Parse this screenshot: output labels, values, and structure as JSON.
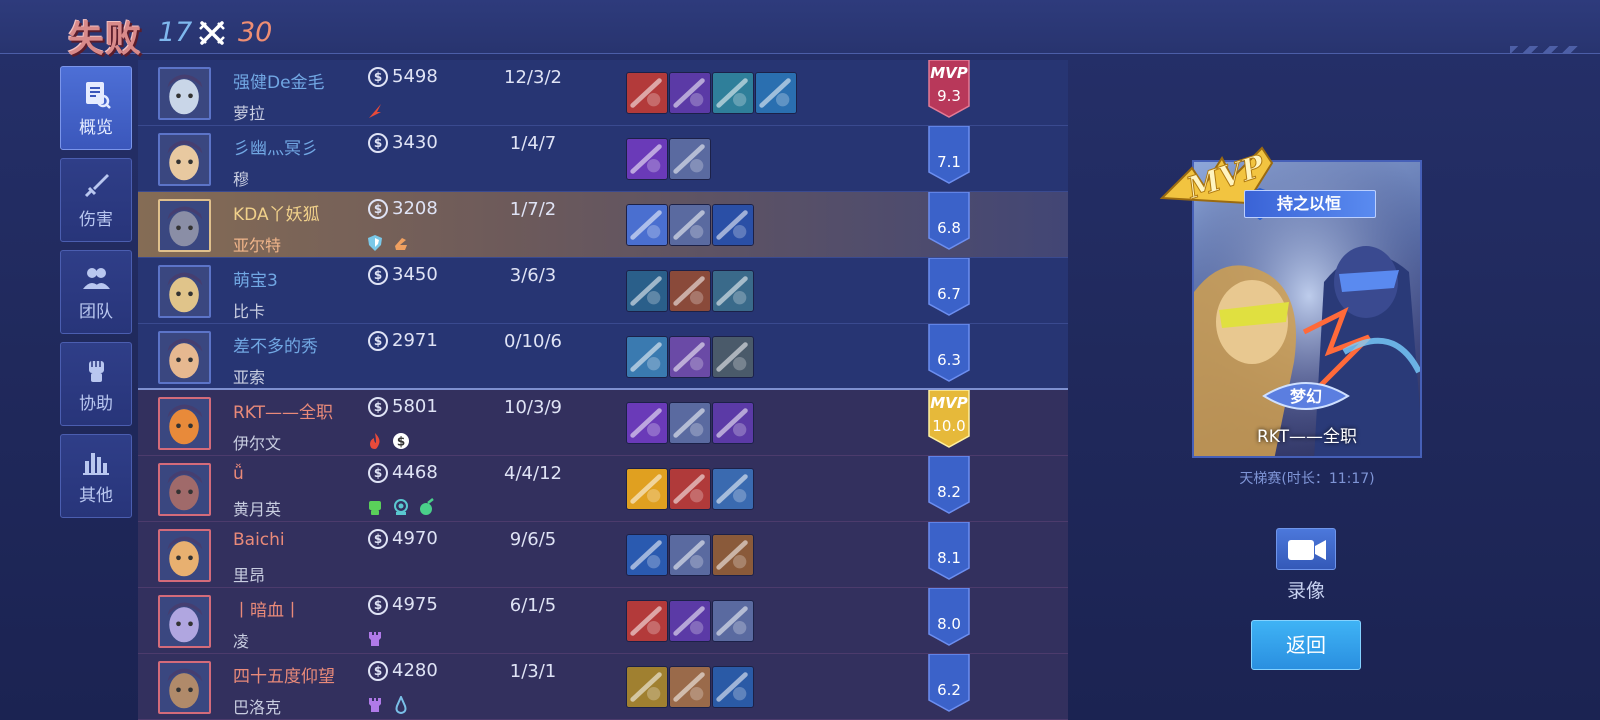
{
  "header": {
    "result": "失败",
    "score_blue": "17",
    "score_red": "30"
  },
  "sidebar": {
    "items": [
      {
        "label": "概览",
        "icon": "overview-icon",
        "active": true
      },
      {
        "label": "伤害",
        "icon": "sword-icon",
        "active": false
      },
      {
        "label": "团队",
        "icon": "team-icon",
        "active": false
      },
      {
        "label": "协助",
        "icon": "fist-icon",
        "active": false
      },
      {
        "label": "其他",
        "icon": "bar-chart-icon",
        "active": false
      }
    ]
  },
  "players": [
    {
      "team": "blue",
      "name": "强健De金毛",
      "hero": "萝拉",
      "gold": "5498",
      "kda": "12/3/2",
      "rating": "9.3",
      "mvp": true,
      "mvp_label": "MVP",
      "badges": [
        "flame-red-icon"
      ],
      "avatar_color": "#c9d6e8",
      "items": [
        "#b33a3a",
        "#5b3aa6",
        "#2f7f9a",
        "#2a6fb0"
      ]
    },
    {
      "team": "blue",
      "name": "彡幽灬冥彡",
      "hero": "穆",
      "gold": "3430",
      "kda": "1/4/7",
      "rating": "7.1",
      "mvp": false,
      "badges": [],
      "avatar_color": "#e8c9a0",
      "items": [
        "#6a3ab8",
        "#5a6aa0"
      ]
    },
    {
      "team": "blue",
      "name": "KDA丫妖狐",
      "hero": "亚尔特",
      "gold": "3208",
      "kda": "1/7/2",
      "rating": "6.8",
      "mvp": false,
      "self": true,
      "badges": [
        "shield-icon",
        "hand-icon"
      ],
      "avatar_color": "#8a8ea6",
      "items": [
        "#4a6fd0",
        "#5a6aa0",
        "#2a4fa6"
      ]
    },
    {
      "team": "blue",
      "name": "萌宝3",
      "hero": "比卡",
      "gold": "3450",
      "kda": "3/6/3",
      "rating": "6.7",
      "mvp": false,
      "badges": [],
      "avatar_color": "#e0c48a",
      "items": [
        "#2a5f8a",
        "#8a4a3a",
        "#3a6a8a"
      ]
    },
    {
      "team": "blue",
      "name": "差不多的秀",
      "hero": "亚索",
      "gold": "2971",
      "kda": "0/10/6",
      "rating": "6.3",
      "mvp": false,
      "badges": [],
      "avatar_color": "#e6b890",
      "items": [
        "#3a7ab0",
        "#6a4aa6",
        "#4a5a6a"
      ]
    },
    {
      "team": "red",
      "name": "RKT——全职",
      "hero": "伊尔文",
      "gold": "5801",
      "kda": "10/3/9",
      "rating": "10.0",
      "mvp": true,
      "mvp_label": "MVP",
      "badges": [
        "fire-icon",
        "gold-coin-icon"
      ],
      "avatar_color": "#e88a3a",
      "items": [
        "#6a3ab8",
        "#5a6aa0",
        "#5b3aa6"
      ]
    },
    {
      "team": "red",
      "name": "ǚ",
      "hero": "黄月英",
      "gold": "4468",
      "kda": "4/4/12",
      "rating": "8.2",
      "mvp": false,
      "badges": [
        "fist-green-icon",
        "camera-green-icon",
        "potion-green-icon"
      ],
      "avatar_color": "#a06a6a",
      "items": [
        "#e0a020",
        "#b03a3a",
        "#3a6ab0"
      ]
    },
    {
      "team": "red",
      "name": "Baichi",
      "hero": "里昂",
      "gold": "4970",
      "kda": "9/6/5",
      "rating": "8.1",
      "mvp": false,
      "badges": [],
      "avatar_color": "#e8b070",
      "items": [
        "#2a5ab0",
        "#5a6aa0",
        "#8a5a3a"
      ]
    },
    {
      "team": "red",
      "name": "丨暗血丨",
      "hero": "凌",
      "gold": "4975",
      "kda": "6/1/5",
      "rating": "8.0",
      "mvp": false,
      "badges": [
        "tower-purple-icon"
      ],
      "avatar_color": "#b0a6e0",
      "items": [
        "#b33a3a",
        "#5b3aa6",
        "#5a6aa0"
      ]
    },
    {
      "team": "red",
      "name": "四十五度仰望",
      "hero": "巴洛克",
      "gold": "4280",
      "kda": "1/3/1",
      "rating": "6.2",
      "mvp": false,
      "badges": [
        "tower-purple-icon",
        "flame-blue-icon"
      ],
      "avatar_color": "#b08a6a",
      "items": [
        "#a08030",
        "#9a6a4a",
        "#2a5aa6"
      ]
    }
  ],
  "mvp_card": {
    "tag": "持之以恒",
    "player": "RKT——全职",
    "skin_label": "梦幻",
    "logo": "MVP"
  },
  "match_info": "天梯赛(时长：11:17)",
  "record": {
    "label": "录像"
  },
  "back": {
    "label": "返回"
  },
  "colors": {
    "blue_name": "#71a7e3",
    "red_name": "#e98a79",
    "self_name": "#f0d08a",
    "mvp_gold": "#e6b93a",
    "mvp_red": "#b8385a",
    "rating_blue": "#3b62c9"
  }
}
